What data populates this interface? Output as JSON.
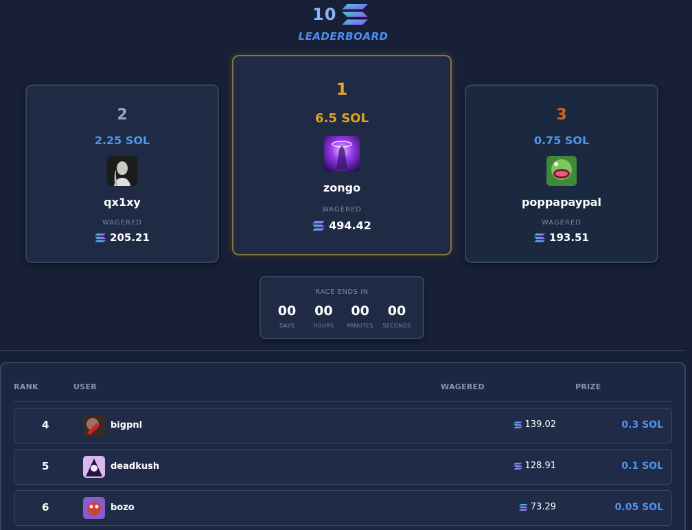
{
  "header": {
    "prize_pool": "10",
    "currency_icon": "solana-logo-icon",
    "title": "LEADERBOARD"
  },
  "podium": {
    "first": {
      "rank": "1",
      "prize": "6.5 SOL",
      "username": "zongo",
      "wagered_label": "WAGERED",
      "wagered": "494.42"
    },
    "second": {
      "rank": "2",
      "prize": "2.25 SOL",
      "username": "qx1xy",
      "wagered_label": "WAGERED",
      "wagered": "205.21"
    },
    "third": {
      "rank": "3",
      "prize": "0.75 SOL",
      "username": "poppapaypal",
      "wagered_label": "WAGERED",
      "wagered": "193.51"
    }
  },
  "timer": {
    "label": "RACE ENDS IN",
    "days": "00",
    "days_label": "DAYS",
    "hours": "00",
    "hours_label": "HOURS",
    "minutes": "00",
    "minutes_label": "MINUTES",
    "seconds": "00",
    "seconds_label": "SECONDS"
  },
  "table": {
    "headers": {
      "rank": "RANK",
      "user": "USER",
      "wagered": "WAGERED",
      "prize": "PRIZE"
    },
    "rows": [
      {
        "rank": "4",
        "username": "bigpnl",
        "wagered": "139.02",
        "prize": "0.3 SOL"
      },
      {
        "rank": "5",
        "username": "deadkush",
        "wagered": "128.91",
        "prize": "0.1 SOL"
      },
      {
        "rank": "6",
        "username": "bozo",
        "wagered": "73.29",
        "prize": "0.05 SOL"
      }
    ]
  },
  "colors": {
    "background": "#172036",
    "card": "#1f2a45",
    "gold": "#e0a622",
    "silver": "#9aa6bb",
    "bronze": "#d8631f",
    "accent_blue": "#4f94f0"
  }
}
